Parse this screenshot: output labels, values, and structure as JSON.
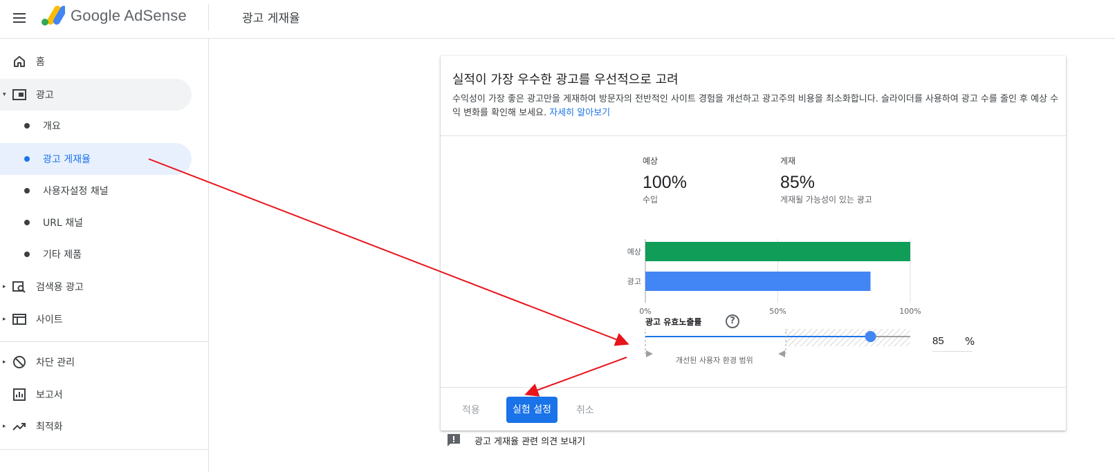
{
  "app": {
    "brand": "Google AdSense",
    "page_title": "광고 게재율"
  },
  "sidebar": {
    "items": [
      {
        "label": "홈",
        "icon": "home-icon"
      },
      {
        "label": "광고",
        "icon": "ads-icon"
      },
      {
        "label": "개요"
      },
      {
        "label": "광고 게재율"
      },
      {
        "label": "사용자설정 채널"
      },
      {
        "label": "URL 채널"
      },
      {
        "label": "기타 제품"
      },
      {
        "label": "검색용 광고",
        "icon": "search-ads-icon"
      },
      {
        "label": "사이트",
        "icon": "sites-icon"
      },
      {
        "label": "차단 관리",
        "icon": "block-icon"
      },
      {
        "label": "보고서",
        "icon": "reports-icon"
      },
      {
        "label": "최적화",
        "icon": "trending-up-icon"
      }
    ]
  },
  "card": {
    "title": "실적이 가장 우수한 광고를 우선적으로 고려",
    "description": "수익성이 가장 좋은 광고만을 게재하여 방문자의 전반적인 사이트 경험을 개선하고 광고주의 비용을 최소화합니다. 슬라이더를 사용하여 광고 수를 줄인 후 예상 수익 변화를 확인해 보세요. ",
    "learn_more": "자세히 알아보기",
    "stats": {
      "estimated": {
        "label": "예상",
        "value": "100%",
        "sub": "수입"
      },
      "served": {
        "label": "게재",
        "value": "85%",
        "sub": "게재될 가능성이 있는 광고"
      }
    },
    "slider": {
      "title": "광고 유효노출률",
      "help": "?",
      "value": 85,
      "input_value": "85",
      "unit": "%",
      "improved_range_label": "개선된 사용자 환경 범위",
      "improved_range_end": 53
    },
    "actions": {
      "apply": "적용",
      "experiment": "실험 설정",
      "cancel": "취소"
    }
  },
  "chart_data": {
    "type": "bar",
    "orientation": "horizontal",
    "categories": [
      "예상",
      "광고"
    ],
    "values": [
      100,
      85
    ],
    "colors": [
      "#0f9d58",
      "#4285f4"
    ],
    "xlim": [
      0,
      100
    ],
    "xticks": [
      "0%",
      "50%",
      "100%"
    ],
    "grid": true
  },
  "feedback": {
    "label": "광고 게재율 관련 의견 보내기"
  },
  "colors": {
    "accent": "#1a73e8",
    "estimated_bar": "#0f9d58",
    "ads_bar": "#4285f4",
    "annotation_arrow": "#e8141c"
  }
}
